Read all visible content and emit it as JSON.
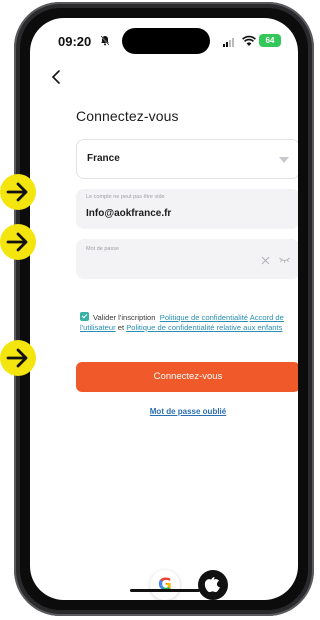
{
  "status_bar": {
    "time": "09:20",
    "battery": "64"
  },
  "page": {
    "title": "Connectez-vous"
  },
  "country_select": {
    "value": "France"
  },
  "account_field": {
    "hint": "Le compte ne peut pas être vide",
    "value": "Info@aokfrance.fr"
  },
  "password_field": {
    "placeholder": "Mot de passe"
  },
  "consent": {
    "checked": true,
    "text": "Valider l'inscription",
    "link_privacy": "Politique de confidentialité",
    "link_user_agreement": "Accord de l'utilisateur",
    "conjunction": "et",
    "link_children_privacy": "Politique de confidentialité relative aux enfants"
  },
  "buttons": {
    "login": "Connectez-vous",
    "forgot_password": "Mot de passe oublié"
  },
  "social": {
    "google_icon": "google-icon",
    "apple_icon": "apple-icon",
    "google_letter": "G"
  },
  "colors": {
    "accent_orange": "#f05a2a",
    "checkbox_teal": "#38b2a3",
    "link_blue": "#2a8fb0",
    "annotation_yellow": "#f5e50f"
  }
}
